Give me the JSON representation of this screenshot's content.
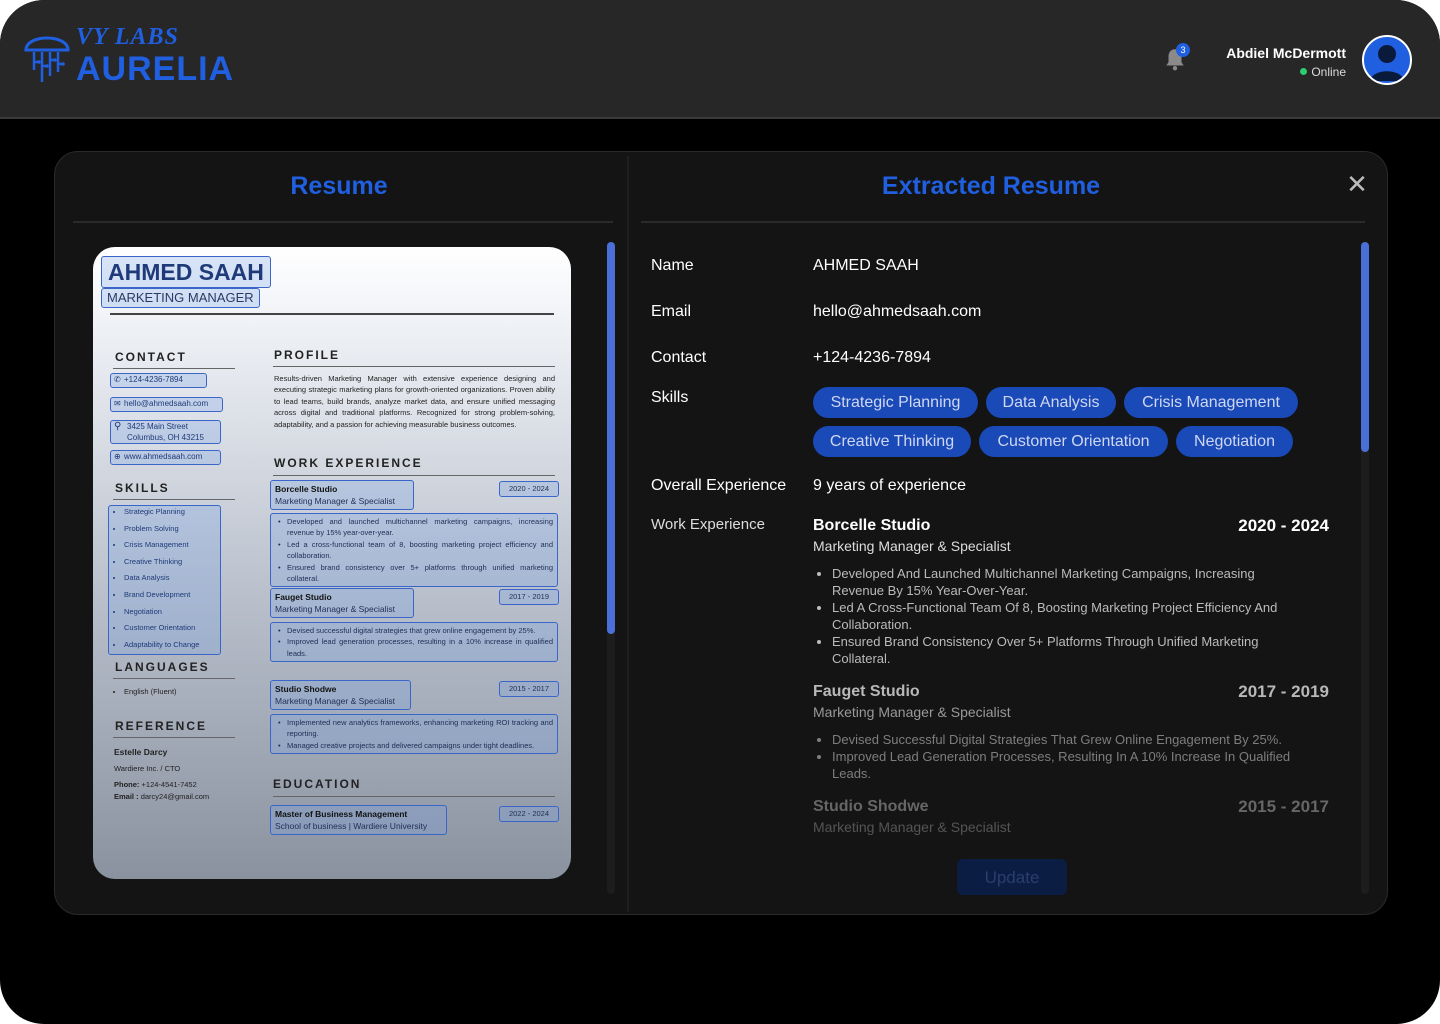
{
  "brand": {
    "sub": "VY LABS",
    "main": "AURELIA"
  },
  "header": {
    "notifications": "3",
    "user_name": "Abdiel McDermott",
    "status": "Online"
  },
  "left": {
    "title": "Resume"
  },
  "right": {
    "title": "Extracted Resume",
    "close": "✕"
  },
  "resume_doc": {
    "name": "AHMED SAAH",
    "role": "MARKETING MANAGER",
    "contact_heading": "CONTACT",
    "phone": "+124-4236-7894",
    "email": "hello@ahmedsaah.com",
    "address_1": "3425 Main Street",
    "address_2": "Columbus, OH 43215",
    "website": "www.ahmedsaah.com",
    "skills_heading": "SKILLS",
    "skills": [
      "Strategic Planning",
      "Problem Solving",
      "Crisis Management",
      "Creative Thinking",
      "Data Analysis",
      "Brand Development",
      "Negotiation",
      "Customer Orientation",
      "Adaptability to Change"
    ],
    "languages_heading": "LANGUAGES",
    "languages": [
      "English (Fluent)"
    ],
    "reference_heading": "REFERENCE",
    "ref_name": "Estelle Darcy",
    "ref_org": "Wardiere Inc. / CTO",
    "ref_phone_label": "Phone:",
    "ref_phone": "+124-4541-7452",
    "ref_email_label": "Email :",
    "ref_email": "darcy24@gmail.com",
    "profile_heading": "PROFILE",
    "profile": "Results-driven Marketing Manager with extensive experience designing and executing strategic marketing plans for growth-oriented organizations. Proven ability to lead teams, build brands, analyze market data, and ensure unified messaging across digital and traditional platforms. Recognized for strong problem-solving, adaptability, and a passion for achieving measurable business outcomes.",
    "work_heading": "WORK EXPERIENCE",
    "jobs": [
      {
        "company": "Borcelle Studio",
        "role": "Marketing Manager & Specialist",
        "date": "2020 - 2024",
        "bullets": [
          "Developed and launched multichannel marketing campaigns, increasing revenue by 15% year-over-year.",
          "Led a cross-functional team of 8, boosting marketing project efficiency and collaboration.",
          "Ensured brand consistency over 5+ platforms through unified marketing collateral."
        ]
      },
      {
        "company": "Fauget Studio",
        "role": "Marketing Manager & Specialist",
        "date": "2017 - 2019",
        "bullets": [
          "Devised successful digital strategies that grew online engagement by 25%.",
          "Improved lead generation processes, resulting in a 10% increase in qualified leads."
        ]
      },
      {
        "company": "Studio Shodwe",
        "role": "Marketing Manager & Specialist",
        "date": "2015 - 2017",
        "bullets": [
          "Implemented new analytics frameworks, enhancing marketing ROI tracking and reporting.",
          "Managed creative projects and delivered campaigns under tight deadlines."
        ]
      }
    ],
    "education_heading": "EDUCATION",
    "degree": "Master of Business Management",
    "school": "School of business | Wardiere University",
    "edu_date": "2022 - 2024"
  },
  "extracted": {
    "name_label": "Name",
    "name_value": "AHMED SAAH",
    "email_label": "Email",
    "email_value": "hello@ahmedsaah.com",
    "contact_label": "Contact",
    "contact_value": "+124-4236-7894",
    "skills_label": "Skills",
    "skills": [
      "Strategic Planning",
      "Data Analysis",
      "Crisis Management",
      "Creative Thinking",
      "Customer Orientation",
      "Negotiation"
    ],
    "experience_label": "Overall Experience",
    "experience_value": "9 years of experience",
    "work_label": "Work Experience",
    "jobs": [
      {
        "company": "Borcelle Studio",
        "date": "2020 - 2024",
        "role": "Marketing Manager & Specialist",
        "bullets": [
          "Developed And Launched Multichannel Marketing Campaigns, Increasing Revenue By 15% Year-Over-Year.",
          "Led A Cross-Functional Team Of 8, Boosting Marketing Project Efficiency And Collaboration.",
          "Ensured Brand Consistency Over 5+ Platforms Through Unified Marketing Collateral."
        ]
      },
      {
        "company": "Fauget Studio",
        "date": "2017 - 2019",
        "role": "Marketing Manager & Specialist",
        "bullets": [
          "Devised Successful Digital Strategies That Grew Online Engagement By 25%.",
          "Improved Lead Generation Processes, Resulting In A 10% Increase In Qualified Leads."
        ]
      },
      {
        "company": "Studio Shodwe",
        "date": "2015 - 2017",
        "role": "Marketing Manager & Specialist",
        "bullets": []
      }
    ],
    "update_label": "Update"
  },
  "colors": {
    "accent": "#1f5fe0",
    "chip": "#1a49b8",
    "bg": "#000000",
    "panel": "#141414"
  }
}
